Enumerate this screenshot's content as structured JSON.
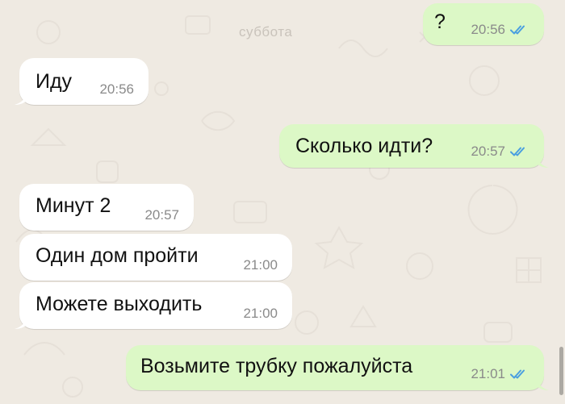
{
  "chat": {
    "date_label": "суббота",
    "messages": [
      {
        "direction": "outgoing",
        "text": "?",
        "time": "20:56",
        "status": "read"
      },
      {
        "direction": "incoming",
        "text": "Иду",
        "time": "20:56"
      },
      {
        "direction": "outgoing",
        "text": "Сколько идти?",
        "time": "20:57",
        "status": "read"
      },
      {
        "direction": "incoming",
        "text": "Минут 2",
        "time": "20:57"
      },
      {
        "direction": "incoming",
        "text": "Один дом пройти",
        "time": "21:00"
      },
      {
        "direction": "incoming",
        "text": "Можете выходить",
        "time": "21:00"
      },
      {
        "direction": "outgoing",
        "text": "Возьмите трубку пожалуйста",
        "time": "21:01",
        "status": "read"
      }
    ]
  },
  "colors": {
    "background": "#efeae2",
    "incoming_bubble": "#ffffff",
    "outgoing_bubble": "#dcf8c6",
    "read_ticks": "#4a9fe0",
    "time_text": "#8a8a8a"
  }
}
